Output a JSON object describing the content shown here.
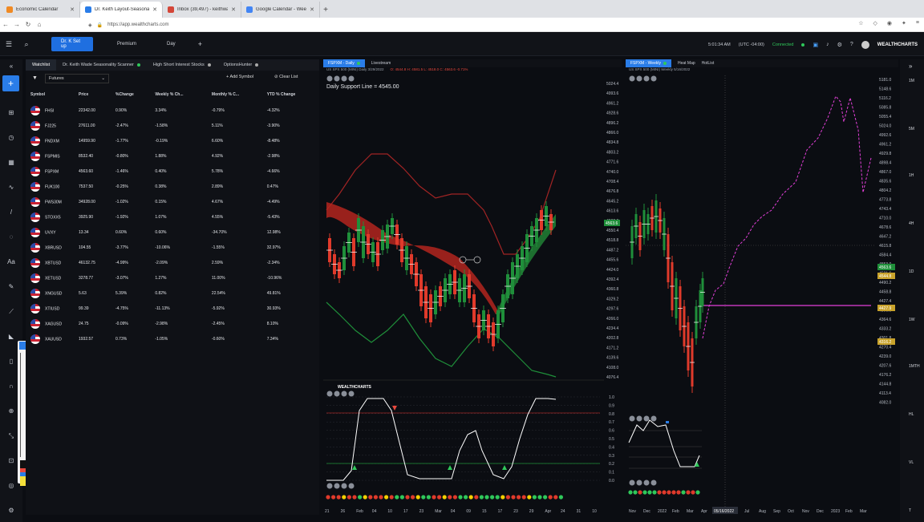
{
  "browser": {
    "tabs": [
      {
        "label": "Economic Calendar",
        "color": "#f08a24"
      },
      {
        "label": "Dr. Keith Layout-Seasonal - We",
        "color": "#2a7de8"
      },
      {
        "label": "Inbox (39,497) - keithwade...",
        "color": "#d44638"
      },
      {
        "label": "Google Calendar - Week of Ma",
        "color": "#4285f4"
      }
    ],
    "url": "https://app.wealthcharts.com"
  },
  "header": {
    "layouts": [
      "Dr. K Set up",
      "Premium",
      "Day"
    ],
    "time": "5:01:34 AM",
    "timezone": "(UTC -04:00)",
    "status": "Connected",
    "brand": "WEALTHCHARTS"
  },
  "watchlist": {
    "tabs": [
      "Watchlist",
      "Dr. Keith Wade Seasonality Scanner",
      "High Short Interest Stocks",
      "OptionsHunter"
    ],
    "filter": "Futures",
    "add_label": "Add Symbol",
    "clear_label": "Clear List",
    "columns": [
      "Symbol",
      "Price",
      "%Change",
      "Weekly % Ch...",
      "Monthly % C...",
      "YTD % Change"
    ],
    "rows": [
      [
        "FHSI",
        "22342.00",
        "0.90%",
        "3.34%",
        "-0.79%",
        "-4.32%"
      ],
      [
        "FJ225",
        "27611.00",
        "-2.47%",
        "-1.58%",
        "5.11%",
        "-3.90%"
      ],
      [
        "FNDXM",
        "14959.90",
        "-1.77%",
        "-0.19%",
        "6.60%",
        "-8.48%"
      ],
      [
        "FSPMIS",
        "8532.40",
        "-0.80%",
        "1.88%",
        "4.92%",
        "-2.98%"
      ],
      [
        "FSPXM",
        "4563.60",
        "-1.46%",
        "0.40%",
        "5.78%",
        "-4.66%"
      ],
      [
        "FUK100",
        "7537.50",
        "-0.25%",
        "0.38%",
        "2.89%",
        "0.47%"
      ],
      [
        "FWS30M",
        "34928.00",
        "-1.02%",
        "0.15%",
        "4.67%",
        "-4.49%"
      ],
      [
        "STOXX5",
        "3925.90",
        "-1.92%",
        "1.07%",
        "4.55%",
        "-5.43%"
      ],
      [
        "UVXY",
        "13.34",
        "0.60%",
        "0.60%",
        "-34.70%",
        "12.98%"
      ],
      [
        "XBRUSD",
        "104.55",
        "-3.77%",
        "-10.06%",
        "-1.55%",
        "32.97%"
      ],
      [
        "XBTUSD",
        "46132.75",
        "-4.99%",
        "-2.09%",
        "2.59%",
        "-2.34%"
      ],
      [
        "XETUSD",
        "3278.77",
        "-3.07%",
        "1.27%",
        "11.00%",
        "-10.96%"
      ],
      [
        "XNGUSD",
        "5.63",
        "5.39%",
        "0.82%",
        "22.54%",
        "49.81%"
      ],
      [
        "XTIUSD",
        "99.39",
        "-4.75%",
        "-11.13%",
        "-5.92%",
        "30.93%"
      ],
      [
        "XAGUSD",
        "24.75",
        "-0.09%",
        "-2.98%",
        "-2.45%",
        "8.10%"
      ],
      [
        "XAUUSD",
        "1932.57",
        "0.73%",
        "-1.05%",
        "-0.60%",
        "7.34%"
      ]
    ]
  },
  "chart1": {
    "symbol": "FSPXM - Daily",
    "tab2": "Livestream",
    "subtitle": "US SPX 500 (MINI)  Daily  3/29/2022",
    "ohlc": "O: 4544.8  H: 4581.5  L: 4518.0  C: 4563.6  -0.71%",
    "annotation": "Daily Support Line = 4545.00",
    "price_labels": [
      "5024.4",
      "4993.6",
      "4961.2",
      "4928.6",
      "4896.2",
      "4866.0",
      "4834.8",
      "4803.2",
      "4771.6",
      "4740.0",
      "4708.4",
      "4676.8",
      "4645.2",
      "4613.6",
      "4582.0",
      "4550.4",
      "4518.8",
      "4487.2",
      "4455.6",
      "4424.0",
      "4392.4",
      "4360.8",
      "4329.2",
      "4297.6",
      "4266.0",
      "4234.4",
      "4202.8",
      "4171.2",
      "4139.6",
      "4108.0",
      "4076.4"
    ],
    "last_price": "4563.6",
    "osc_labels": [
      "1.0",
      "0.9",
      "0.8",
      "0.7",
      "0.6",
      "0.5",
      "0.4",
      "0.3",
      "0.2",
      "0.1",
      "0.0"
    ],
    "dates": [
      "21",
      "26",
      "Feb",
      "04",
      "10",
      "17",
      "23",
      "Mar",
      "04",
      "09",
      "15",
      "17",
      "23",
      "29",
      "Apr",
      "24",
      "31",
      "10"
    ],
    "logo": "WEALTHCHARTS"
  },
  "chart2": {
    "symbol": "FSPXM - Weekly",
    "tab2": "Heat Map",
    "tab3": "HotList",
    "subtitle": "US SPX 500 (MINI)  Weekly  5/16/2022",
    "price_labels": [
      "5181.0",
      "5148.6",
      "5116.2",
      "5085.8",
      "5055.4",
      "5024.0",
      "4992.6",
      "4961.2",
      "4929.8",
      "4898.4",
      "4867.0",
      "4835.6",
      "4804.2",
      "4773.8",
      "4743.4",
      "4710.0",
      "4678.6",
      "4647.2",
      "4615.8",
      "4584.4",
      "4553.0",
      "4521.6",
      "4490.2",
      "4458.8",
      "4427.4",
      "4396.0",
      "4364.6",
      "4333.2",
      "4301.8",
      "4270.4",
      "4239.0",
      "4207.6",
      "4176.2",
      "4144.8",
      "4113.4",
      "4082.0"
    ],
    "tags": [
      {
        "v": "4563.6",
        "color": "#1f8f3a"
      },
      {
        "v": "4544.8",
        "color": "#c8a22b"
      },
      {
        "v": "4427.9",
        "color": "#c8a22b"
      },
      {
        "v": "4316.2",
        "color": "#c8a22b"
      }
    ],
    "dates": [
      "Nov",
      "Dec",
      "2022",
      "Feb",
      "Mar",
      "Apr",
      "May",
      "Jun",
      "Jul",
      "Aug",
      "Sep",
      "Oct",
      "Nov",
      "Dec",
      "2023",
      "Feb",
      "Mar"
    ],
    "cursor_date": "05/16/2022"
  },
  "timeframes": [
    "1M",
    "5M",
    "1H",
    "4H",
    "1D",
    "1W",
    "1MTH",
    "HL",
    "VL",
    "T"
  ]
}
